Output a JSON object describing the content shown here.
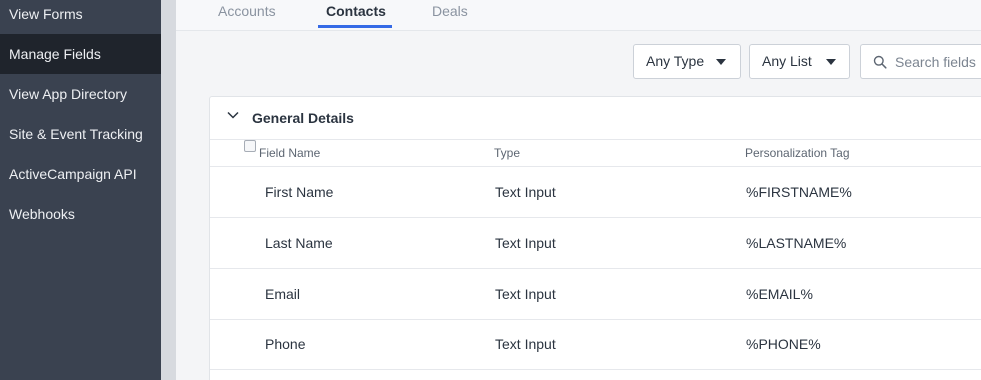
{
  "sidebar": {
    "items": [
      {
        "label": "View Forms",
        "active": false
      },
      {
        "label": "Manage Fields",
        "active": true
      },
      {
        "label": "View App Directory",
        "active": false
      },
      {
        "label": "Site & Event Tracking",
        "active": false
      },
      {
        "label": "ActiveCampaign API",
        "active": false
      },
      {
        "label": "Webhooks",
        "active": false
      }
    ]
  },
  "tabs": [
    {
      "label": "Accounts",
      "active": false
    },
    {
      "label": "Contacts",
      "active": true
    },
    {
      "label": "Deals",
      "active": false
    }
  ],
  "filters": {
    "type_select": "Any Type",
    "list_select": "Any List",
    "search_placeholder": "Search fields",
    "search_value": ""
  },
  "section": {
    "title": "General Details",
    "expanded": true,
    "columns": {
      "field_name": "Field Name",
      "type": "Type",
      "tag": "Personalization Tag"
    },
    "rows": [
      {
        "name": "First Name",
        "type": "Text Input",
        "tag": "%FIRSTNAME%"
      },
      {
        "name": "Last Name",
        "type": "Text Input",
        "tag": "%LASTNAME%"
      },
      {
        "name": "Email",
        "type": "Text Input",
        "tag": "%EMAIL%"
      },
      {
        "name": "Phone",
        "type": "Text Input",
        "tag": "%PHONE%"
      }
    ]
  },
  "colors": {
    "sidebar_bg": "#3a4250",
    "sidebar_active_bg": "#1f242c",
    "accent": "#356ae6"
  },
  "icons": {
    "search": "search-icon",
    "dropdown": "chevron-down-icon",
    "collapse": "chevron-down-icon"
  }
}
